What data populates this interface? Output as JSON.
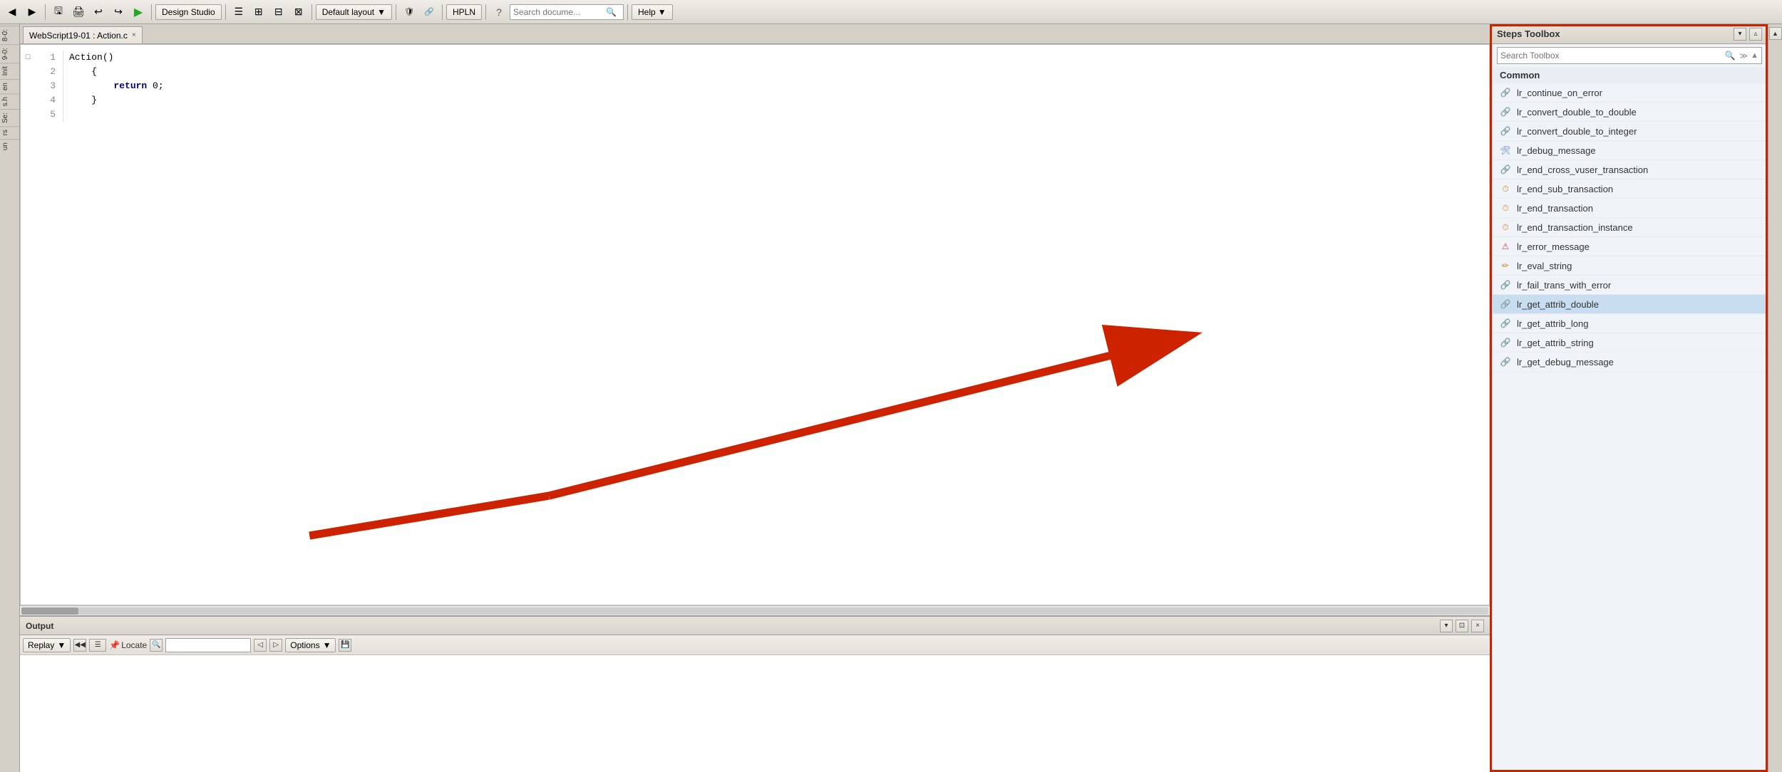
{
  "toolbar": {
    "design_studio_label": "Design Studio",
    "layout_label": "Default layout",
    "hpln_label": "HPLN",
    "help_label": "Help",
    "search_placeholder": "Search docume...",
    "layout_chevron": "▼"
  },
  "tab": {
    "title": "WebScript19-01 : Action.c",
    "close": "×"
  },
  "code": {
    "lines": [
      {
        "num": "1",
        "marker": "□",
        "content": "Action()"
      },
      {
        "num": "2",
        "marker": "",
        "content": "    {"
      },
      {
        "num": "3",
        "marker": "",
        "content": "        return 0;"
      },
      {
        "num": "4",
        "marker": "",
        "content": "    }"
      },
      {
        "num": "5",
        "marker": "",
        "content": ""
      }
    ]
  },
  "left_nav": {
    "items": [
      "8-0:",
      "9-0:",
      "Init",
      "en",
      "s.h",
      "Se:",
      "rs",
      "un"
    ]
  },
  "output": {
    "title": "Output",
    "replay_label": "Replay",
    "replay_chevron": "▼",
    "locate_label": "Locate",
    "options_label": "Options",
    "options_chevron": "▼"
  },
  "toolbox": {
    "title": "Steps Toolbox",
    "search_placeholder": "Search Toolbox",
    "category": "Common",
    "items": [
      {
        "id": "lr_continue_on_error",
        "label": "lr_continue_on_error",
        "icon_type": "link"
      },
      {
        "id": "lr_convert_double_to_double",
        "label": "lr_convert_double_to_double",
        "icon_type": "link"
      },
      {
        "id": "lr_convert_double_to_integer",
        "label": "lr_convert_double_to_integer",
        "icon_type": "link"
      },
      {
        "id": "lr_debug_message",
        "label": "lr_debug_message",
        "icon_type": "debug"
      },
      {
        "id": "lr_end_cross_vuser_transaction",
        "label": "lr_end_cross_vuser_transaction",
        "icon_type": "link"
      },
      {
        "id": "lr_end_sub_transaction",
        "label": "lr_end_sub_transaction",
        "icon_type": "clock"
      },
      {
        "id": "lr_end_transaction",
        "label": "lr_end_transaction",
        "icon_type": "clock"
      },
      {
        "id": "lr_end_transaction_instance",
        "label": "lr_end_transaction_instance",
        "icon_type": "clock"
      },
      {
        "id": "lr_error_message",
        "label": "lr_error_message",
        "icon_type": "error"
      },
      {
        "id": "lr_eval_string",
        "label": "lr_eval_string",
        "icon_type": "pencil"
      },
      {
        "id": "lr_fail_trans_with_error",
        "label": "lr_fail_trans_with_error",
        "icon_type": "link"
      },
      {
        "id": "lr_get_attrib_double",
        "label": "lr_get_attrib_double",
        "icon_type": "link",
        "selected": true
      },
      {
        "id": "lr_get_attrib_long",
        "label": "lr_get_attrib_long",
        "icon_type": "link"
      },
      {
        "id": "lr_get_attrib_string",
        "label": "lr_get_attrib_string",
        "icon_type": "link"
      },
      {
        "id": "lr_get_debug_message",
        "label": "lr_get_debug_message",
        "icon_type": "link"
      }
    ]
  },
  "icons": {
    "link_char": "🔗",
    "debug_char": "🛠",
    "clock_char": "⏱",
    "error_char": "⚠",
    "pencil_char": "✏"
  }
}
